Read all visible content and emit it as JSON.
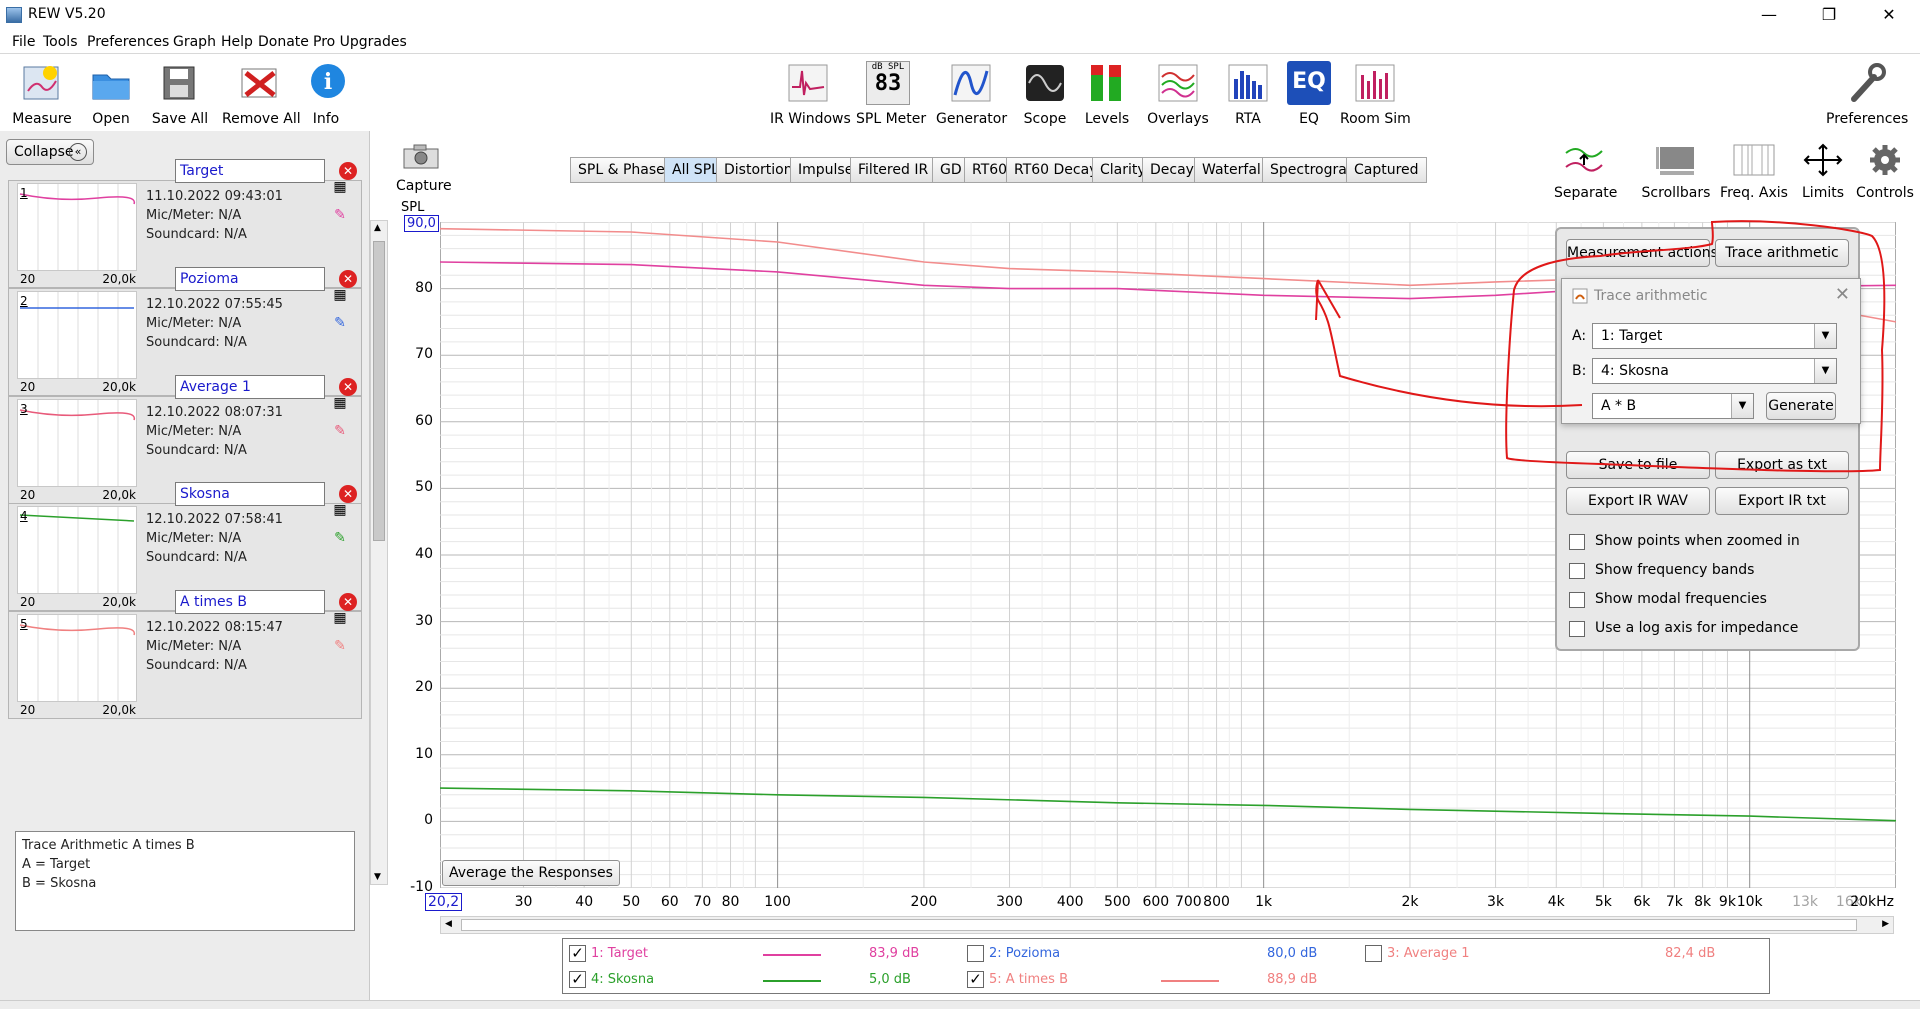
{
  "window": {
    "title": "REW V5.20",
    "minimize": "—",
    "maximize": "❐",
    "close": "✕"
  },
  "menu": [
    "File",
    "Tools",
    "Preferences",
    "Graph",
    "Help",
    "Donate",
    "Pro Upgrades"
  ],
  "toolbar_left": [
    {
      "label": "Measure",
      "icon": "measure-icon"
    },
    {
      "label": "Open",
      "icon": "folder-icon"
    },
    {
      "label": "Save All",
      "icon": "save-all-icon"
    },
    {
      "label": "Remove All",
      "icon": "remove-all-icon"
    },
    {
      "label": "Info",
      "icon": "info-icon"
    }
  ],
  "toolbar_center": [
    {
      "label": "IR Windows",
      "icon": "ir-windows-icon"
    },
    {
      "label": "SPL Meter",
      "icon": "spl-meter-icon",
      "badge_top": "dB SPL",
      "badge_value": "83"
    },
    {
      "label": "Generator",
      "icon": "generator-icon"
    },
    {
      "label": "Scope",
      "icon": "scope-icon"
    },
    {
      "label": "Levels",
      "icon": "levels-icon"
    },
    {
      "label": "Overlays",
      "icon": "overlays-icon"
    },
    {
      "label": "RTA",
      "icon": "rta-icon"
    },
    {
      "label": "EQ",
      "icon": "eq-icon"
    },
    {
      "label": "Room Sim",
      "icon": "room-sim-icon"
    }
  ],
  "toolbar_right": {
    "label": "Preferences",
    "icon": "wrench-icon"
  },
  "left_panel": {
    "collapse_label": "Collapse",
    "collapse_glyph": "«",
    "measurements": [
      {
        "num": "1",
        "name": "Target",
        "date": "11.10.2022 09:43:01",
        "mic": "Mic/Meter: N/A",
        "soundcard": "Soundcard: N/A",
        "lo": "20",
        "hi": "20,0k",
        "color": "#e040a0"
      },
      {
        "num": "2",
        "name": "Pozioma",
        "date": "12.10.2022 07:55:45",
        "mic": "Mic/Meter: N/A",
        "soundcard": "Soundcard: N/A",
        "lo": "20",
        "hi": "20,0k",
        "color": "#3366dd"
      },
      {
        "num": "3",
        "name": "Average 1",
        "date": "12.10.2022 08:07:31",
        "mic": "Mic/Meter: N/A",
        "soundcard": "Soundcard: N/A",
        "lo": "20",
        "hi": "20,0k",
        "color": "#e85a7a"
      },
      {
        "num": "4",
        "name": "Skosna",
        "date": "12.10.2022 07:58:41",
        "mic": "Mic/Meter: N/A",
        "soundcard": "Soundcard: N/A",
        "lo": "20",
        "hi": "20,0k",
        "color": "#2ba02b"
      },
      {
        "num": "5",
        "name": "A times B",
        "date": "12.10.2022 08:15:47",
        "mic": "Mic/Meter: N/A",
        "soundcard": "Soundcard: N/A",
        "lo": "20",
        "hi": "20,0k",
        "color": "#f08080"
      }
    ],
    "notes": [
      "Trace Arithmetic A times B",
      "A = Target",
      "B = Skosna"
    ]
  },
  "capture_label": "Capture",
  "graph_tabs": [
    "SPL & Phase",
    "All SPL",
    "Distortion",
    "Impulse",
    "Filtered IR",
    "GD",
    "RT60",
    "RT60 Decay",
    "Clarity",
    "Decay",
    "Waterfall",
    "Spectrogram",
    "Captured"
  ],
  "active_tab": "All SPL",
  "right_tools": [
    {
      "label": "Separate",
      "icon": "separate-icon"
    },
    {
      "label": "Scrollbars",
      "icon": "scrollbars-icon"
    },
    {
      "label": "Freq. Axis",
      "icon": "freq-axis-icon"
    },
    {
      "label": "Limits",
      "icon": "limits-icon"
    },
    {
      "label": "Controls",
      "icon": "gear-icon"
    }
  ],
  "average_button": "Average the Responses",
  "chart_data": {
    "type": "line",
    "xlabel": "",
    "ylabel": "SPL",
    "x_scale": "log",
    "xlim": [
      20.2,
      20000
    ],
    "ylim": [
      -10,
      90
    ],
    "y_top_box": "90,0",
    "x_left_box": "20,2",
    "yticks": [
      "80",
      "70",
      "60",
      "50",
      "40",
      "30",
      "20",
      "10",
      "0",
      "-10"
    ],
    "xticks": [
      {
        "v": 30,
        "t": "30"
      },
      {
        "v": 40,
        "t": "40"
      },
      {
        "v": 50,
        "t": "50"
      },
      {
        "v": 60,
        "t": "60"
      },
      {
        "v": 70,
        "t": "70"
      },
      {
        "v": 80,
        "t": "80"
      },
      {
        "v": 100,
        "t": "100"
      },
      {
        "v": 200,
        "t": "200"
      },
      {
        "v": 300,
        "t": "300"
      },
      {
        "v": 400,
        "t": "400"
      },
      {
        "v": 500,
        "t": "500"
      },
      {
        "v": 600,
        "t": "600"
      },
      {
        "v": 700,
        "t": "700"
      },
      {
        "v": 800,
        "t": "800"
      },
      {
        "v": 1000,
        "t": "1k"
      },
      {
        "v": 2000,
        "t": "2k"
      },
      {
        "v": 3000,
        "t": "3k"
      },
      {
        "v": 4000,
        "t": "4k"
      },
      {
        "v": 5000,
        "t": "5k"
      },
      {
        "v": 6000,
        "t": "6k"
      },
      {
        "v": 7000,
        "t": "7k"
      },
      {
        "v": 8000,
        "t": "8k"
      },
      {
        "v": 9000,
        "t": "9k"
      },
      {
        "v": 10000,
        "t": "10k"
      },
      {
        "v": 13000,
        "t": "13k",
        "minor": true
      },
      {
        "v": 16000,
        "t": "16k",
        "minor": true
      },
      {
        "v": 20000,
        "t": "20kHz"
      }
    ],
    "series": [
      {
        "name": "1: Target",
        "color": "#e040a0",
        "x": [
          20.2,
          50,
          100,
          200,
          300,
          500,
          1000,
          2000,
          3000,
          5000,
          20000
        ],
        "y": [
          84,
          83.6,
          82.5,
          80.5,
          80,
          80,
          79,
          78.5,
          79,
          80,
          80.5
        ]
      },
      {
        "name": "5: A times B",
        "color": "#f28c8c",
        "x": [
          20.2,
          50,
          100,
          200,
          300,
          500,
          1000,
          2000,
          3000,
          5000,
          10000,
          20000
        ],
        "y": [
          89,
          88.5,
          87,
          84,
          83,
          82.5,
          81.5,
          80.5,
          81,
          81.5,
          79,
          75
        ]
      },
      {
        "name": "4: Skosna",
        "color": "#2ba02b",
        "x": [
          20.2,
          50,
          100,
          200,
          500,
          1000,
          2000,
          5000,
          10000,
          20000
        ],
        "y": [
          5,
          4.6,
          4,
          3.6,
          2.8,
          2.4,
          1.8,
          1.2,
          0.8,
          0.1
        ]
      }
    ]
  },
  "legend": [
    {
      "checked": true,
      "label": "1: Target",
      "color": "#e040a0",
      "value": "83,9 dB"
    },
    {
      "checked": false,
      "label": "2: Pozioma",
      "color": "#3366dd",
      "value": "80,0 dB"
    },
    {
      "checked": false,
      "label": "3: Average 1",
      "color": "#f08080",
      "value": "82,4 dB"
    },
    {
      "checked": true,
      "label": "4: Skosna",
      "color": "#2ba02b",
      "value": "5,0 dB"
    },
    {
      "checked": true,
      "label": "5: A times B",
      "color": "#f08080",
      "value": "88,9 dB"
    }
  ],
  "dock": {
    "measurement_actions": "Measurement actions",
    "trace_arithmetic": "Trace arithmetic",
    "save_to_file": "Save to file",
    "export_as_txt": "Export as txt",
    "export_ir_wav": "Export IR WAV",
    "export_ir_txt": "Export IR txt",
    "checkboxes": [
      "Show points when zoomed in",
      "Show frequency bands",
      "Show modal frequencies",
      "Use a log axis for impedance"
    ]
  },
  "ta_dialog": {
    "title": "Trace arithmetic",
    "a_label": "A:",
    "a_value": "1: Target",
    "b_label": "B:",
    "b_value": "4: Skosna",
    "op_value": "A * B",
    "generate": "Generate"
  }
}
